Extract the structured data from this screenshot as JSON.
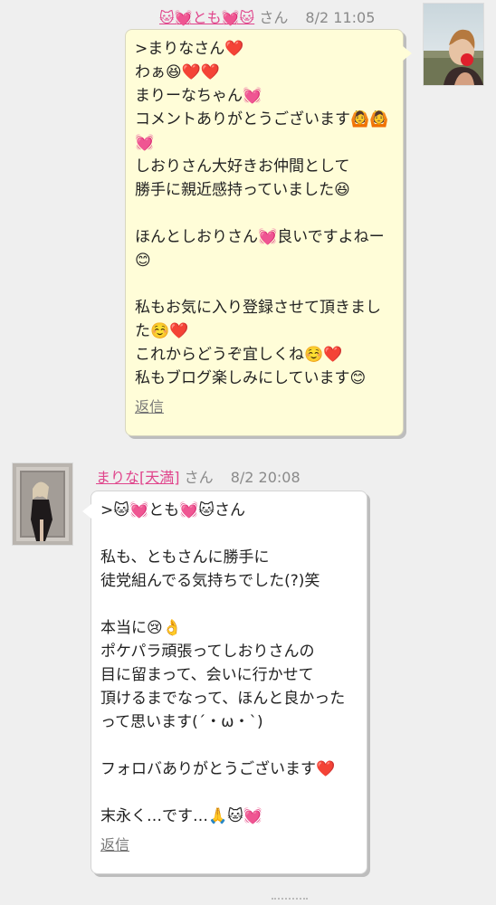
{
  "comments": [
    {
      "name": "🐱💓とも💓🐱",
      "suffix": "さん",
      "time": "8/2 11:05",
      "lines": [
        ">まりなさん❤️",
        "わぁ😆❤️❤️",
        "まりーなちゃん💓",
        "コメントありがとうございます🙆🙆",
        "💓",
        "しおりさん大好きお仲間として",
        "勝手に親近感持っていました😆",
        "",
        "ほんとしおりさん💓良いですよねー",
        "😊",
        "",
        "私もお気に入り登録させて頂きまし",
        "た☺️❤️",
        "これからどうぞ宜しくね☺️❤️",
        "私もブログ楽しみにしています😊"
      ],
      "reply_label": "返信"
    },
    {
      "name": "まりな[天満]",
      "suffix": "さん",
      "time": "8/2 20:08",
      "lines": [
        ">🐱💓とも💓🐱さん",
        "",
        "私も、ともさんに勝手に",
        "徒党組んでる気持ちでした(?)笑",
        "",
        "本当に😢👌",
        "ポケパラ頑張ってしおりさんの",
        "目に留まって、会いに行かせて",
        "頂けるまでなって、ほんと良かった",
        "って思います(´・ω・`)",
        "",
        "フォロバありがとうございます❤️",
        "",
        "末永く…です…🙏🐱💓"
      ],
      "reply_label": "返信"
    }
  ]
}
